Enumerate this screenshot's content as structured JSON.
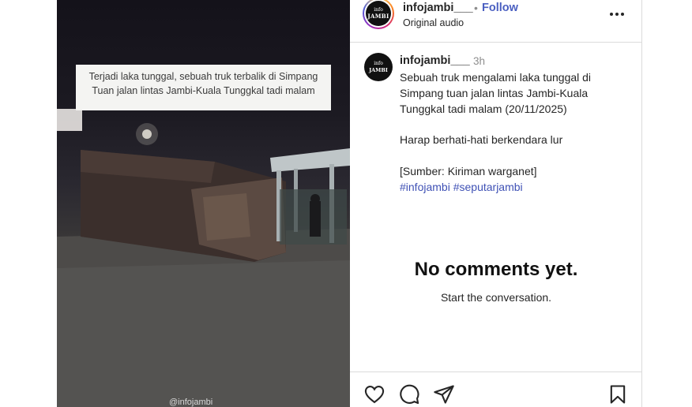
{
  "video": {
    "caption": "Terjadi laka tunggal, sebuah truk terbalik di Simpang Tuan jalan lintas Jambi-Kuala Tunggkal tadi malam",
    "watermark": "@infojambi"
  },
  "header": {
    "username": "infojambi___",
    "separator": "•",
    "follow_label": "Follow",
    "audio_label": "Original audio",
    "avatar_text_top": "info",
    "avatar_text_bottom": "JAMBI"
  },
  "post": {
    "username": "infojambi___",
    "time": "3h",
    "lines": [
      "Sebuah truk mengalami laka tunggal di",
      "Simpang tuan jalan lintas Jambi-Kuala",
      "Tunggkal tadi malam (20/11/2025)"
    ],
    "line2": "Harap berhati-hati berkendara lur",
    "line3": "[Sumber: Kiriman warganet]",
    "hashtags": [
      "#infojambi",
      "#seputarjambi"
    ]
  },
  "comments": {
    "empty_title": "No comments yet.",
    "empty_subtitle": "Start the conversation."
  },
  "actions": {
    "icons": [
      "heart-icon",
      "comment-icon",
      "share-icon",
      "bookmark-icon"
    ]
  },
  "colors": {
    "follow": "#4a5fc1",
    "hashtag": "#3f51b5",
    "border": "#dbdbdb"
  }
}
